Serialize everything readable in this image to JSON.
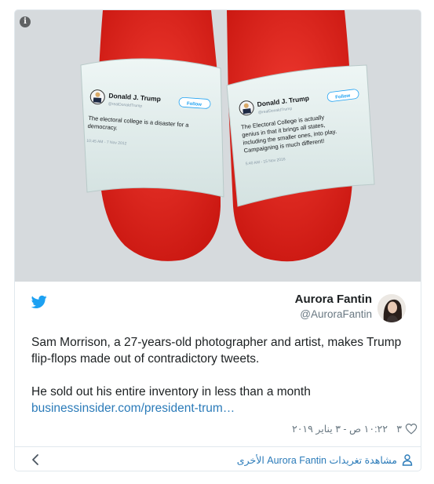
{
  "media": {
    "info_icon": "info-icon",
    "left_tweet": {
      "name": "Donald J. Trump",
      "handle": "@realDonaldTrump",
      "follow_label": "Follow",
      "text_line1": "The electoral college is a disaster for a",
      "text_line2": "democracy.",
      "time": "10:45 AM - 7 Nov 2012"
    },
    "right_tweet": {
      "name": "Donald J. Trump",
      "handle": "@realDonaldTrump",
      "follow_label": "Follow",
      "text_line1": "The Electoral College is actually",
      "text_line2": "genius in that it brings all states,",
      "text_line3": "including the smaller ones, into play.",
      "text_line4": "Campaigning is much different!",
      "time": "5:40 AM - 15 Nov 2016"
    },
    "colors": {
      "slide_red": "#e0201c",
      "strap": "#ddeae9",
      "background": "#d8dcdf"
    }
  },
  "author": {
    "name": "Aurora Fantin",
    "handle": "@AuroraFantin"
  },
  "body": {
    "paragraph1": "Sam Morrison, a 27-years-old photographer and artist, makes Trump flip-flops made out of contradictory tweets.",
    "paragraph2": "He sold out his entire inventory in less than a month",
    "link": "businessinsider.com/president-trum…"
  },
  "meta": {
    "timestamp": "١٠:٢٢ ص - ٣ يناير ٢٠١٩",
    "like_count": "٣"
  },
  "footer": {
    "more_tweets": "مشاهدة تغريدات Aurora Fantin الأخرى"
  },
  "colors": {
    "link": "#2b7bb9",
    "twitter_blue": "#1da1f2",
    "secondary_text": "#697882"
  }
}
